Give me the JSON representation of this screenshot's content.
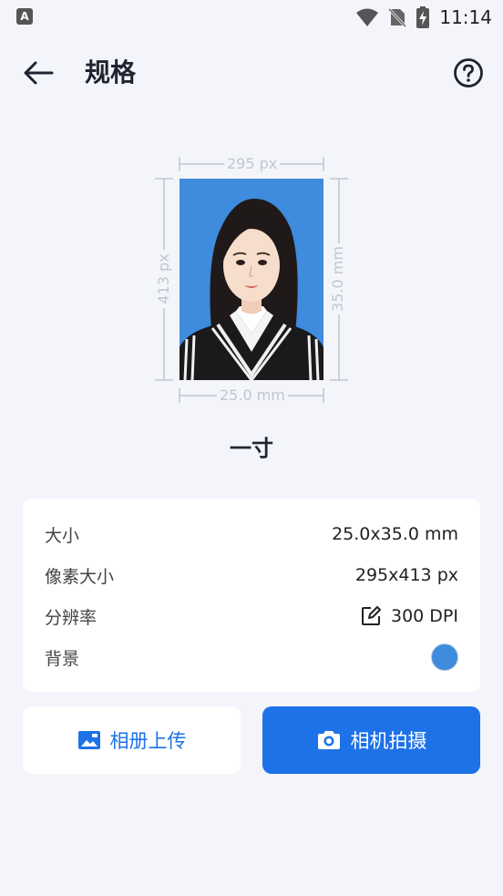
{
  "status_bar": {
    "app_indicator": "A",
    "time": "11:14",
    "icons": [
      "wifi-icon",
      "sim-off-icon",
      "battery-charging-icon"
    ]
  },
  "header": {
    "title": "规格",
    "back_icon": "arrow-left-icon",
    "help_icon": "question-circle-icon"
  },
  "preview": {
    "width_px": "295 px",
    "height_px": "413 px",
    "width_mm": "25.0 mm",
    "height_mm": "35.0 mm",
    "background_color": "#3f8bdd"
  },
  "spec_name": "一寸",
  "details": [
    {
      "label": "大小",
      "value": "25.0x35.0 mm"
    },
    {
      "label": "像素大小",
      "value": "295x413 px"
    },
    {
      "label": "分辨率",
      "value": "300 DPI",
      "icon": "edit-icon"
    },
    {
      "label": "背景",
      "value": "",
      "color": "#3f8bdd"
    }
  ],
  "buttons": {
    "album": "相册上传",
    "camera": "相机拍摄"
  },
  "colors": {
    "accent": "#1d72e8",
    "page_bg": "#f3f5fb"
  }
}
